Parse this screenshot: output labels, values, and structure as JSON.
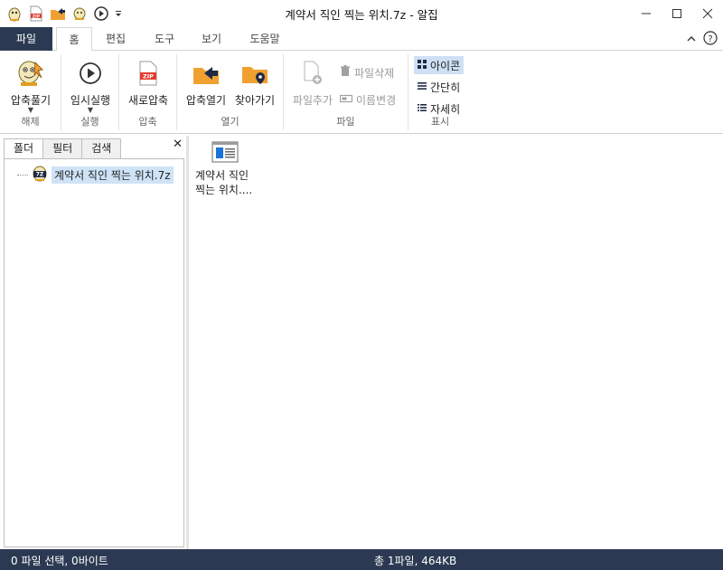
{
  "window": {
    "title": "계약서 직인 찍는 위치.7z - 알집"
  },
  "quick_access": [
    "app-logo-icon",
    "zip-icon",
    "open-folder-icon",
    "extract-icon",
    "play-icon",
    "dropdown-icon"
  ],
  "tabs": [
    {
      "label": "파일"
    },
    {
      "label": "홈"
    },
    {
      "label": "편집"
    },
    {
      "label": "도구"
    },
    {
      "label": "보기"
    },
    {
      "label": "도움말"
    }
  ],
  "ribbon": {
    "groups": {
      "extract": "해제",
      "run": "실행",
      "compress": "압축",
      "open": "열기",
      "file": "파일",
      "view": "표시"
    },
    "buttons": {
      "extract": "압축풀기",
      "temp_run": "임시실행",
      "new_compress": "새로압축",
      "open_archive": "압축열기",
      "find": "찾아가기",
      "add_file": "파일추가",
      "delete_file": "파일삭제",
      "rename": "이름변경",
      "icons": "아이콘",
      "simple": "간단히",
      "details": "자세히"
    }
  },
  "left_pane": {
    "tabs": [
      "폴더",
      "필터",
      "검색"
    ],
    "tree_item": "계약서 직인 찍는 위치.7z"
  },
  "file_list": {
    "items": [
      {
        "line1": "계약서 직인",
        "line2": "찍는 위치...."
      }
    ]
  },
  "status": {
    "selection": "0 파일 선택,  0바이트",
    "total": "총 1파일,  464KB"
  },
  "colors": {
    "dark_navy": "#2b3a52",
    "selection_blue": "#cfe3f7",
    "accent_orange": "#f0a030"
  }
}
